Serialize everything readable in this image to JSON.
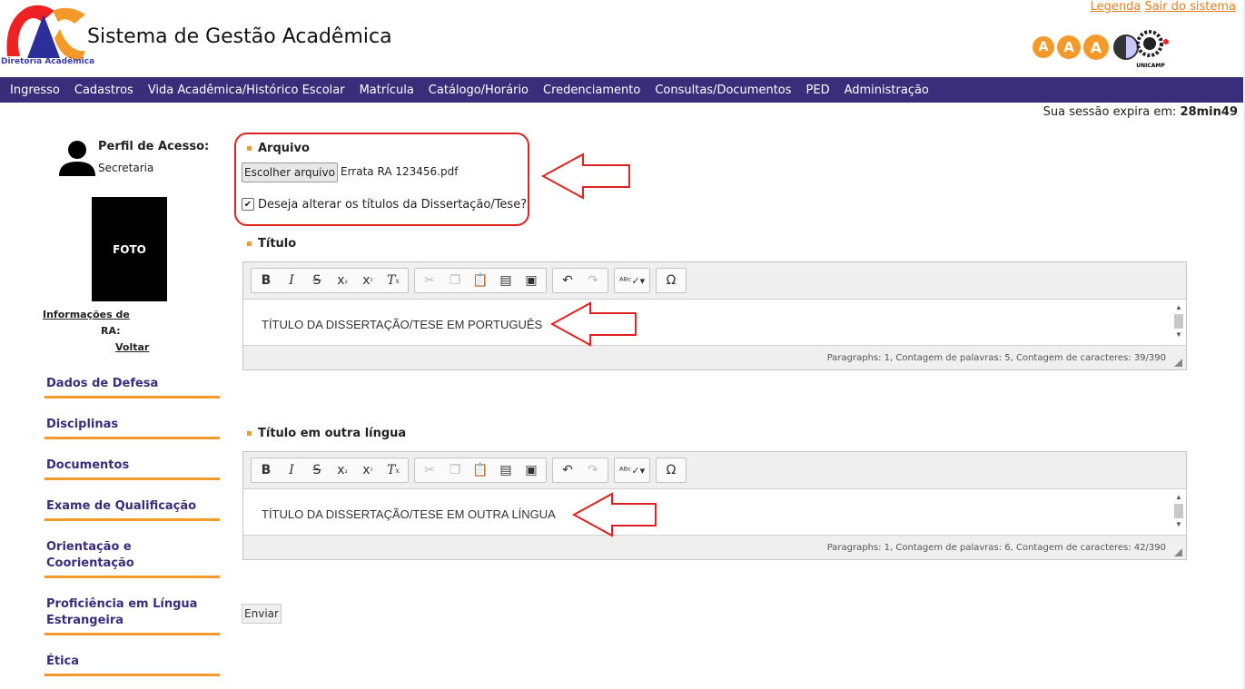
{
  "header": {
    "logo_text": "Diretoria Acadêmica",
    "app_title": "Sistema de Gestão Acadêmica",
    "legend_link": "Legenda",
    "logout_link": "Sair do sistema",
    "accessibility": [
      "A",
      "A",
      "A"
    ],
    "unicamp_label": "UNICAMP"
  },
  "nav": [
    "Ingresso",
    "Cadastros",
    "Vida Acadêmica/Histórico Escolar",
    "Matrícula",
    "Catálogo/Horário",
    "Credenciamento",
    "Consultas/Documentos",
    "PED",
    "Administração"
  ],
  "session": {
    "label": "Sua sessão expira em:",
    "value": "28min49"
  },
  "sidebar": {
    "profile_label": "Perfil de Acesso:",
    "profile_value": "Secretaria",
    "photo_label": "FOTO",
    "info_link": "Informações de",
    "ra_label": "RA:",
    "back_link": "Voltar",
    "items": [
      {
        "label": "Dados de Defesa"
      },
      {
        "label": "Disciplinas"
      },
      {
        "label": "Documentos"
      },
      {
        "label": "Exame de Qualificação"
      },
      {
        "label": "Orientação e Coorientação"
      },
      {
        "label": "Proficiência em Língua Estrangeira"
      },
      {
        "label": "Ética"
      }
    ]
  },
  "arquivo": {
    "title": "Arquivo",
    "button": "Escolher arquivo",
    "file_name": "Errata RA 123456.pdf",
    "checkbox_label": "Deseja alterar os títulos da Dissertação/Tese?",
    "checked": true
  },
  "titulo": {
    "title": "Título",
    "content": "TÍTULO DA DISSERTAÇÃO/TESE EM PORTUGUÊS",
    "status": "Paragraphs: 1, Contagem de palavras: 5, Contagem de caracteres: 39/390"
  },
  "titulo_outra": {
    "title": "Título em outra língua",
    "content": "TÍTULO DA DISSERTAÇÃO/TESE EM OUTRA LÍNGUA",
    "status": "Paragraphs: 1, Contagem de palavras: 6, Contagem de caracteres: 42/390"
  },
  "toolbar_icons": [
    "bold-icon",
    "italic-icon",
    "strike-icon",
    "subscript-icon",
    "superscript-icon",
    "remove-format-icon",
    "cut-icon",
    "copy-icon",
    "paste-icon",
    "paste-text-icon",
    "paste-word-icon",
    "undo-icon",
    "redo-icon",
    "spellcheck-icon",
    "special-char-icon"
  ],
  "send_button": "Enviar",
  "colors": {
    "nav_bg": "#3a2d7a",
    "accent_orange": "#f39a2b",
    "annotation_red": "#d22"
  }
}
